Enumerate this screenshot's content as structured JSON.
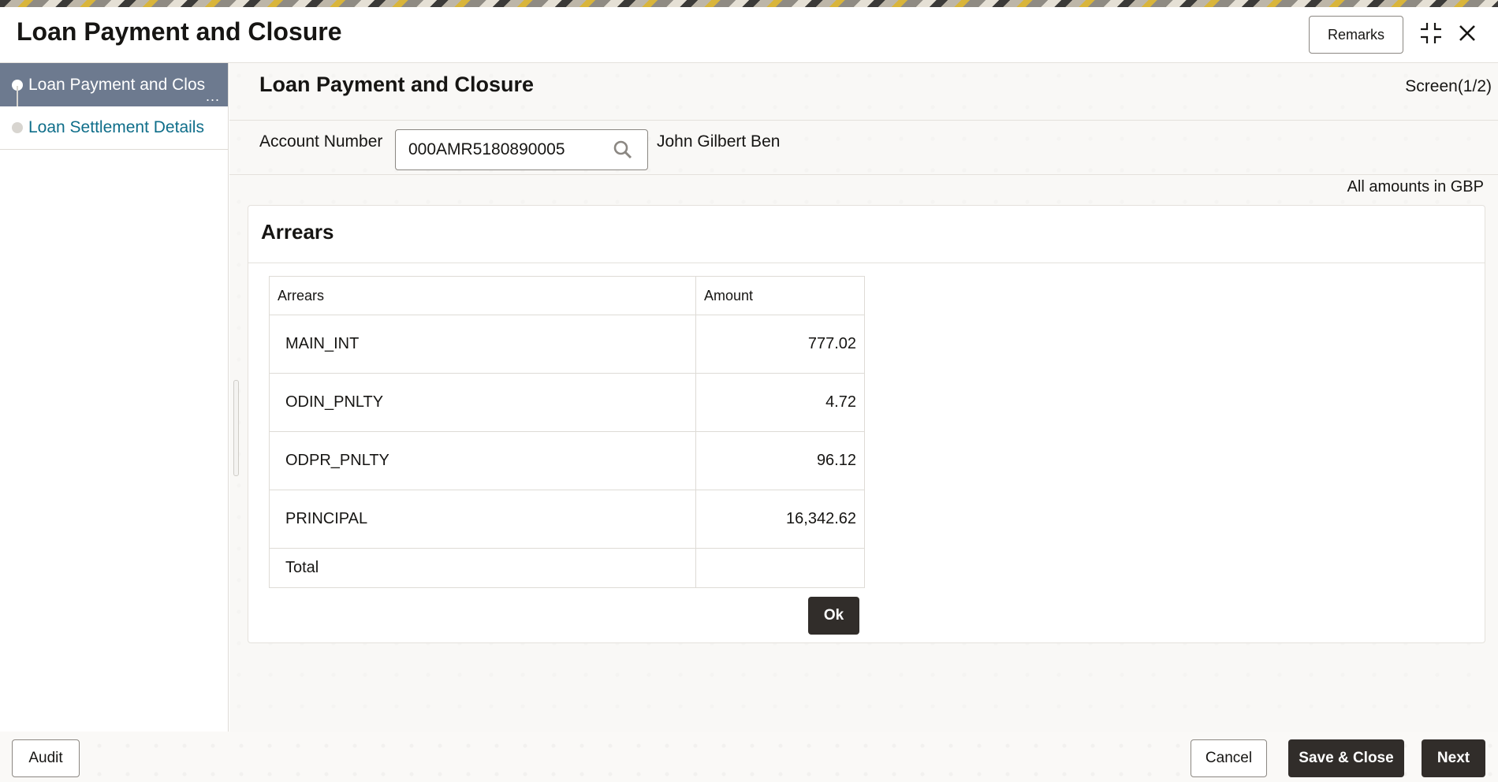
{
  "header": {
    "title": "Loan Payment and Closure",
    "remarks_label": "Remarks"
  },
  "sidebar": {
    "items": [
      {
        "label": "Loan Payment and Clos",
        "more": "..."
      },
      {
        "label": "Loan Settlement Details"
      }
    ]
  },
  "main": {
    "title": "Loan Payment and Closure",
    "screen_indicator": "Screen(1/2)",
    "account_label": "Account Number",
    "account_value": "000AMR5180890005",
    "account_name": "John Gilbert Ben",
    "amounts_note": "All amounts in GBP"
  },
  "arrears": {
    "title": "Arrears",
    "columns": [
      "Arrears",
      "Amount"
    ],
    "rows": [
      {
        "name": "MAIN_INT",
        "amount": "777.02"
      },
      {
        "name": "ODIN_PNLTY",
        "amount": "4.72"
      },
      {
        "name": "ODPR_PNLTY",
        "amount": "96.12"
      },
      {
        "name": "PRINCIPAL",
        "amount": "16,342.62"
      }
    ],
    "total_label": "Total",
    "ok_label": "Ok"
  },
  "footer": {
    "audit_label": "Audit",
    "cancel_label": "Cancel",
    "save_close_label": "Save & Close",
    "next_label": "Next"
  },
  "icons": {
    "search": "search-icon",
    "collapse": "collapse-icon",
    "close": "close-icon"
  }
}
